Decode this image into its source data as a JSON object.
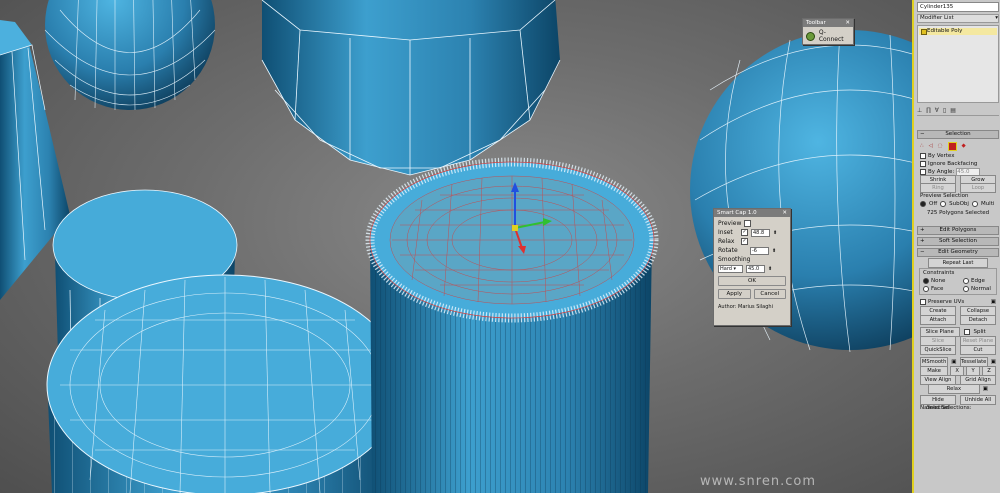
{
  "watermark": "www.snren.com",
  "quad_menu": {
    "title": "Toolbar",
    "item": "Q-Connect"
  },
  "dialog": {
    "title": "Smart Cap 1.0",
    "preview_label": "Preview",
    "inset_label": "Inset",
    "inset_value": "48.8",
    "relax_label": "Relax",
    "rotate_label": "Rotate",
    "rotate_value": "-6",
    "smoothing_label": "Smoothing",
    "smoothing_mode": "Hard",
    "smoothing_value": "45.0",
    "ok_label": "OK",
    "apply_label": "Apply",
    "cancel_label": "Cancel",
    "author": "Author: Marius Silaghi"
  },
  "panel": {
    "object_name": "Cylinder135",
    "modifier_list": "Modifier List",
    "stack_item": "Editable Poly",
    "selection_rollout": "Selection",
    "by_vertex": "By Vertex",
    "ignore_backfacing": "Ignore Backfacing",
    "by_angle": "By Angle:",
    "by_angle_value": "45.0",
    "shrink": "Shrink",
    "grow": "Grow",
    "ring": "Ring",
    "loop": "Loop",
    "preview_selection": "Preview Selection",
    "off": "Off",
    "subobj": "SubObj",
    "multi": "Multi",
    "selected_count": "725 Polygons Selected",
    "edit_polygons": "Edit Polygons",
    "soft_selection": "Soft Selection",
    "edit_geometry": "Edit Geometry",
    "repeat_last": "Repeat Last",
    "constraints": "Constraints",
    "none": "None",
    "edge": "Edge",
    "face": "Face",
    "normal": "Normal",
    "preserve_uvs": "Preserve UVs",
    "create": "Create",
    "collapse": "Collapse",
    "attach": "Attach",
    "detach": "Detach",
    "slice_plane": "Slice Plane",
    "split": "Split",
    "slice": "Slice",
    "reset_plane": "Reset Plane",
    "quickslice": "QuickSlice",
    "cut": "Cut",
    "msmooth": "MSmooth",
    "tessellate": "Tessellate",
    "make_planar": "Make Planar",
    "x": "X",
    "y": "Y",
    "z": "Z",
    "view_align": "View Align",
    "grid_align": "Grid Align",
    "relax": "Relax",
    "hide_selected": "Hide Selected",
    "unhide_all": "Unhide All",
    "named_selections": "Named Selections:"
  },
  "colors": {
    "mesh_fill": "#3fa3d2",
    "wire": "#ffffff",
    "selection_wire": "#d04040",
    "panel_border": "#e0d020"
  }
}
